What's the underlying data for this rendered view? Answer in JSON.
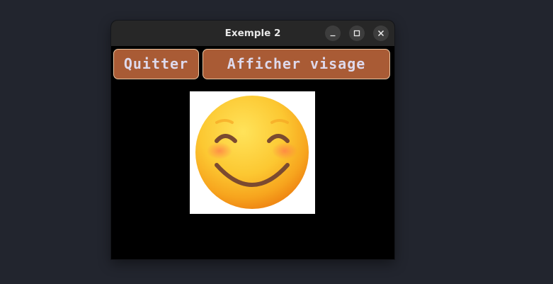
{
  "window": {
    "title": "Exemple 2"
  },
  "toolbar": {
    "quit_label": "Quitter",
    "show_face_label": "Afficher visage"
  },
  "image": {
    "icon": "smiling-face-icon"
  },
  "colors": {
    "desktop": "#22252e",
    "titlebar": "#272727",
    "button_fill": "#a95b35",
    "button_border": "#e9c5a2",
    "button_text": "#ded9ec",
    "content_bg": "#000000"
  }
}
